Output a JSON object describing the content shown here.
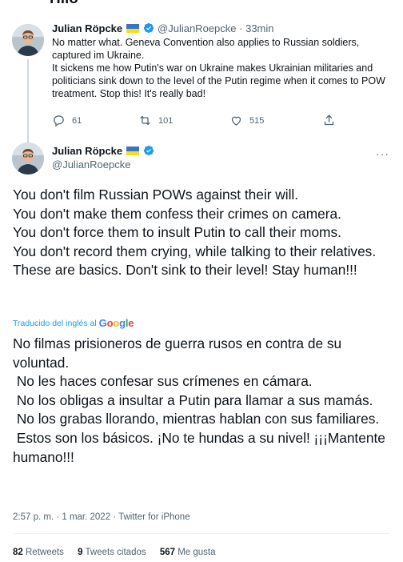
{
  "header": {
    "title": "Hilo"
  },
  "parent_tweet": {
    "author_name": "Julian Röpcke",
    "handle": "@JulianRoepcke",
    "separator": "·",
    "time": "33min",
    "text_lines": [
      "No matter what. Geneva Convention also applies to Russian soldiers, captured im Ukraine.",
      "It sickens me how Putin's war on Ukraine makes Ukrainian militaries and politicians sink down to the level of the Putin regime when it comes to POW treatment. Stop this! It's really bad!"
    ],
    "replies": "61",
    "retweets": "101",
    "likes": "515"
  },
  "main_tweet": {
    "author_name": "Julian Röpcke",
    "handle": "@JulianRoepcke",
    "more_label": "···",
    "text_lines": [
      "You don't film Russian POWs against their will.",
      "You don't make them confess their crimes on camera.",
      "You don't force them to insult Putin to call their moms.",
      "You don't record them crying, while talking to their relatives.",
      "These are basics. Don't sink to their level! Stay human!!!"
    ],
    "translated_label": "Traducido del inglés al",
    "translated_provider": "Google",
    "translation_lines": [
      "No filmas prisioneros de guerra rusos en contra de su voluntad.",
      " No les haces confesar sus crímenes en cámara.",
      " No los obligas a insultar a Putin para llamar a sus mamás.",
      " No los grabas llorando, mientras hablan con sus familiares.",
      " Estos son los básicos. ¡No te hundas a su nivel! ¡¡¡Mantente humano!!!"
    ],
    "timestamp": "2:57 p. m. · 1 mar. 2022 · Twitter for iPhone",
    "stats": {
      "retweets_count": "82",
      "retweets_label": "Retweets",
      "quotes_count": "9",
      "quotes_label": "Tweets citados",
      "likes_count": "567",
      "likes_label": "Me gusta"
    }
  },
  "colors": {
    "accent": "#1d9bf0",
    "text": "#0f1419",
    "muted": "#536471",
    "flag_blue": "#3a75c4",
    "flag_yellow": "#f9dd16"
  }
}
